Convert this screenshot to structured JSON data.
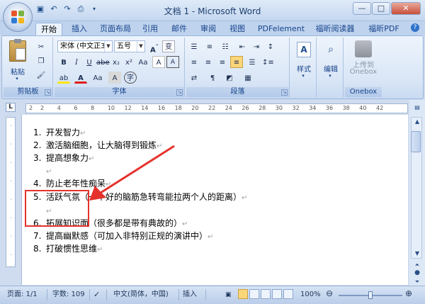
{
  "window": {
    "title": "文档 1 - Microsoft Word",
    "controls": {
      "minimize": "—",
      "maximize": "□",
      "close": "✕"
    }
  },
  "quick_access": {
    "icons": [
      "save-icon",
      "undo-icon",
      "redo-icon",
      "print-preview-icon",
      "customize-icon"
    ]
  },
  "tabs": [
    "开始",
    "插入",
    "页面布局",
    "引用",
    "邮件",
    "审阅",
    "视图",
    "PDFelement",
    "福昕阅读器",
    "福昕PDF"
  ],
  "active_tab": "开始",
  "ribbon": {
    "clipboard": {
      "paste_label": "粘贴",
      "group_label": "剪贴板"
    },
    "font": {
      "font_name": "宋体 (中文正3",
      "font_size": "五号",
      "group_label": "字体"
    },
    "paragraph": {
      "group_label": "段落"
    },
    "styles": {
      "label": "样式"
    },
    "editing": {
      "label": "编辑"
    },
    "onebox": {
      "label_line1": "上传到",
      "label_line2": "Onebox",
      "group_label": "Onebox"
    }
  },
  "ruler": {
    "corner": "L",
    "ticks": [
      "2",
      "2",
      "4",
      "6",
      "8",
      "10",
      "12",
      "14",
      "16",
      "18",
      "20",
      "22",
      "24",
      "26",
      "28",
      "30",
      "32",
      "34",
      "36",
      "38",
      "40",
      "42"
    ]
  },
  "document": {
    "lines": [
      {
        "num": "1.",
        "text": "开发智力"
      },
      {
        "num": "2.",
        "text": "激活脑细胞，让大脑得到锻炼"
      },
      {
        "num": "3.",
        "text": "提高想象力"
      },
      {
        "num": "",
        "text": ""
      },
      {
        "num": "4.",
        "text": "防止老年性痴呆"
      },
      {
        "num": "5.",
        "text": "活跃气氛（一个好的脑筋急转弯能拉两个人的距离）"
      },
      {
        "num": "",
        "text": ""
      },
      {
        "num": "6.",
        "text": "拓展知识面（很多都是带有典故的）"
      },
      {
        "num": "7.",
        "text": "提高幽默感（可加入非特别正规的演讲中）"
      },
      {
        "num": "8.",
        "text": "打破惯性思维"
      }
    ]
  },
  "status": {
    "page": "页面: 1/1",
    "words": "字数: 109",
    "language": "中文(简体，中国)",
    "mode": "插入",
    "zoom": "100%"
  },
  "colors": {
    "accent_red": "#e5322d",
    "ribbon_blue": "#15428b"
  }
}
